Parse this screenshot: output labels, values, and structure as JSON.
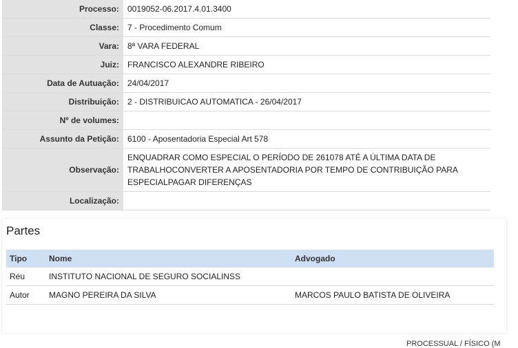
{
  "details": [
    {
      "label": "Processo:",
      "value": "0019052-06.2017.4.01.3400"
    },
    {
      "label": "Classe:",
      "value": "7 - Procedimento Comum"
    },
    {
      "label": "Vara:",
      "value": "8ª VARA FEDERAL"
    },
    {
      "label": "Juiz:",
      "value": "FRANCISCO ALEXANDRE RIBEIRO"
    },
    {
      "label": "Data de Autuação:",
      "value": "24/04/2017"
    },
    {
      "label": "Distribuição:",
      "value": "2 - DISTRIBUICAO AUTOMATICA - 26/04/2017"
    },
    {
      "label": "Nº de volumes:",
      "value": ""
    },
    {
      "label": "Assunto da Petição:",
      "value": "6100 - Aposentadoria Especial Art 578"
    },
    {
      "label": "Observação:",
      "lines": [
        "ENQUADRAR COMO ESPECIAL O PERÍODO DE 261078 ATÉ A ÚLTIMA DATA DE",
        "TRABALHOCONVERTER A APOSENTADORIA POR TEMPO DE CONTRIBUIÇÃO PARA",
        "ESPECIALPAGAR DIFERENÇAS"
      ]
    },
    {
      "label": "Localização:",
      "value": ""
    }
  ],
  "partes": {
    "title": "Partes",
    "headers": {
      "tipo": "Tipo",
      "nome": "Nome",
      "advogado": "Advogado"
    },
    "rows": [
      {
        "tipo": "Réu",
        "nome": "INSTITUTO NACIONAL DE SEGURO SOCIALINSS",
        "advogado": ""
      },
      {
        "tipo": "Autor",
        "nome": "MAGNO PEREIRA DA SILVA",
        "advogado": "MARCOS PAULO BATISTA DE OLIVEIRA"
      }
    ]
  },
  "footer": {
    "partial_text": "PROCESSUAL / FÍSICO (M"
  },
  "colors": {
    "label_bg": "#e2e2e2",
    "table_header_bg": "#cfe0f5"
  }
}
